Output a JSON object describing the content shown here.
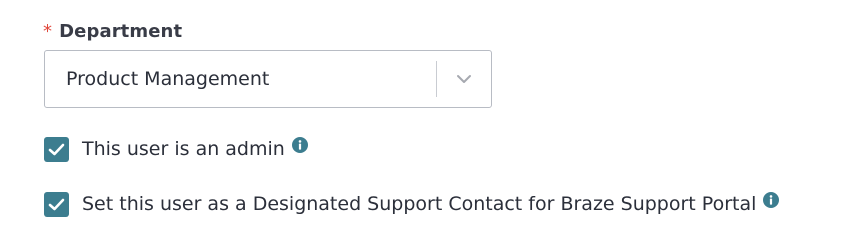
{
  "department": {
    "label": "Department",
    "required_marker": "*",
    "selected_value": "Product Management"
  },
  "options": [
    {
      "label": "This user is an admin",
      "checked": true,
      "has_info": true
    },
    {
      "label": "Set this user as a Designated Support Contact for Braze Support Portal",
      "checked": true,
      "has_info": true
    }
  ],
  "colors": {
    "checkbox": "#3c7d8f",
    "required": "#e0473b",
    "info": "#3c7d8f"
  },
  "icons": {
    "select_arrow": "chevron-down-icon",
    "info": "info-icon",
    "check": "checkmark-icon"
  }
}
